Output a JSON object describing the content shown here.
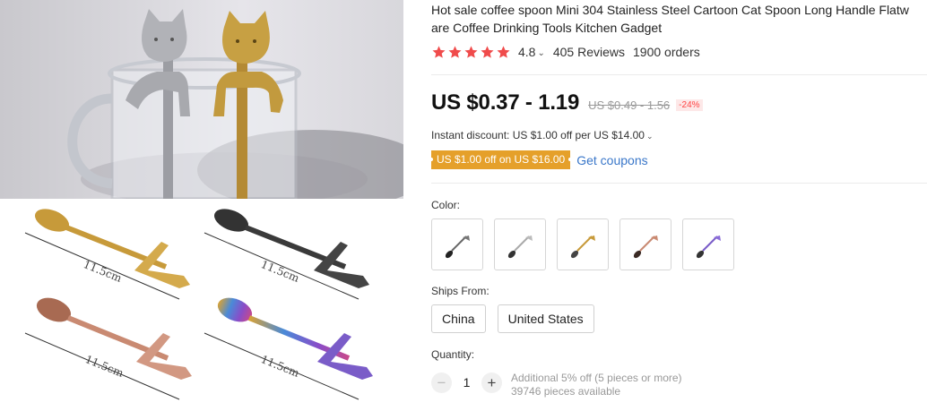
{
  "product": {
    "title_line1": "Hot sale coffee spoon Mini 304 Stainless Steel Cartoon Cat Spoon Long Handle Flatw",
    "title_line2": "are Coffee Drinking Tools Kitchen Gadget"
  },
  "gallery": {
    "dimension_label": "11.5cm",
    "spoon_colors": [
      "#c79a3a",
      "#3a3a3a",
      "#c98a72",
      "#7a5cc8"
    ]
  },
  "rating": {
    "value": "4.8",
    "stars_filled": 5,
    "star_color": "#f04b4b",
    "reviews": "405 Reviews",
    "orders": "1900 orders"
  },
  "pricing": {
    "price": "US $0.37 - 1.19",
    "original_price": "US $0.49 - 1.56",
    "discount": "-24%"
  },
  "promotions": {
    "instant_discount": "Instant discount: US $1.00 off per US $14.00",
    "coupon": "US $1.00 off on US $16.00",
    "get_coupons": "Get coupons"
  },
  "color_section": {
    "label": "Color:",
    "options": [
      "silver",
      "silver-light",
      "gold",
      "rose-gold",
      "rainbow"
    ]
  },
  "shipping": {
    "label": "Ships From:",
    "options": [
      "China",
      "United States"
    ]
  },
  "quantity": {
    "label": "Quantity:",
    "value": "1",
    "minus_icon": "minus-icon",
    "plus_icon": "plus-icon",
    "note_line1": "Additional 5% off (5 pieces or more)",
    "note_line2": "39746 pieces available"
  },
  "colors": {
    "accent_red": "#f04b4b",
    "coupon_orange": "#e5a02a",
    "link_blue": "#3a77c9"
  }
}
